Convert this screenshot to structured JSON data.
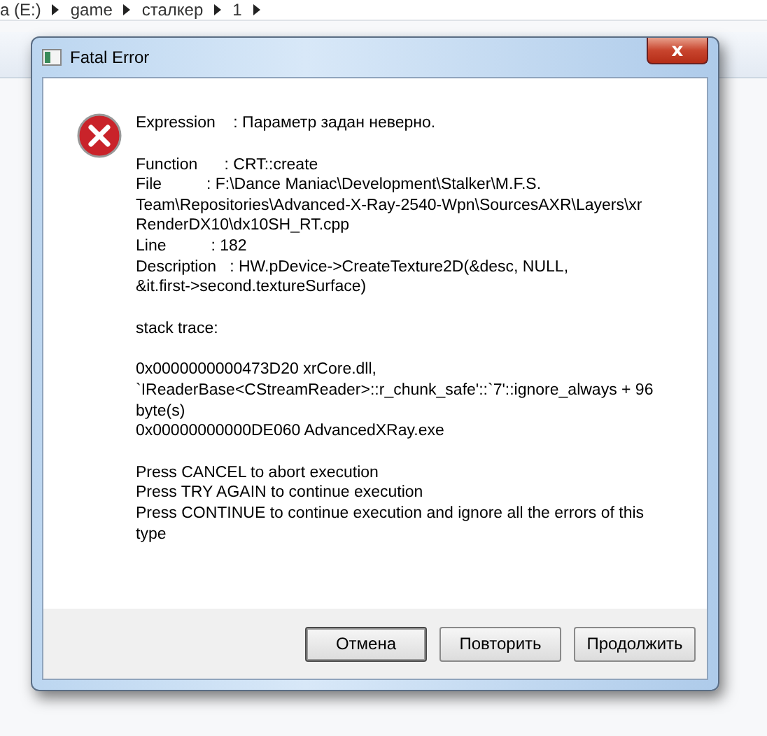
{
  "explorer": {
    "breadcrumb": [
      "а (E:)",
      "game",
      "сталкер",
      "1"
    ]
  },
  "dialog": {
    "title": "Fatal Error",
    "close": "x",
    "paragraphs": [
      [
        "Expression    : Параметр задан неверно."
      ],
      [
        "Function      : CRT::create",
        "File          : F:\\Dance Maniac\\Development\\Stalker\\M.F.S.",
        "Team\\Repositories\\Advanced-X-Ray-2540-Wpn\\SourcesAXR\\Layers\\xr",
        "RenderDX10\\dx10SH_RT.cpp",
        "Line          : 182",
        "Description   : HW.pDevice->CreateTexture2D(&desc, NULL,",
        "&it.first->second.textureSurface)"
      ],
      [
        "stack trace:"
      ],
      [
        "0x0000000000473D20 xrCore.dll,",
        "`IReaderBase<CStreamReader>::r_chunk_safe'::`7'::ignore_always + 96",
        "byte(s)",
        "0x00000000000DE060 AdvancedXRay.exe"
      ],
      [
        "Press CANCEL to abort execution",
        "Press TRY AGAIN to continue execution",
        "Press CONTINUE to continue execution and ignore all the errors of this",
        "type"
      ]
    ],
    "buttons": [
      {
        "label": "Отмена",
        "selected": true
      },
      {
        "label": "Повторить",
        "selected": false
      },
      {
        "label": "Продолжить",
        "selected": false
      }
    ]
  }
}
